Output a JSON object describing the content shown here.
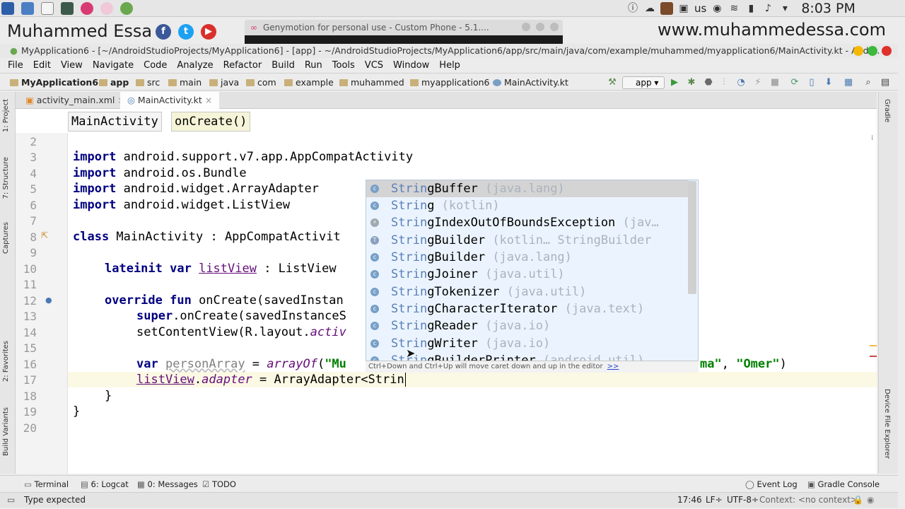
{
  "system_panel": {
    "keyboard_layout": "us",
    "clock": "8:03 PM",
    "tray_icons": [
      "info-icon",
      "cloud-icon",
      "avatar-icon",
      "package-icon",
      "wifi-icon",
      "battery-icon",
      "volume-icon",
      "chevron-down-icon"
    ]
  },
  "watermark": {
    "name": "Muhammed Essa",
    "url": "www.muhammedessa.com"
  },
  "genymotion_tab": {
    "title": "Genymotion for personal use - Custom Phone - 5.1...."
  },
  "window": {
    "title": "MyApplication6 - [~/AndroidStudioProjects/MyApplication6] - [app] - ~/AndroidStudioProjects/MyApplication6/app/src/main/java/com/example/muhammed/myapplication6/MainActivity.kt - Andr..."
  },
  "menu": [
    "File",
    "Edit",
    "View",
    "Navigate",
    "Code",
    "Analyze",
    "Refactor",
    "Build",
    "Run",
    "Tools",
    "VCS",
    "Window",
    "Help"
  ],
  "breadcrumbs": [
    "MyApplication6",
    "app",
    "src",
    "main",
    "java",
    "com",
    "example",
    "muhammed",
    "myapplication6",
    "MainActivity.kt"
  ],
  "run_config": "app",
  "tabs": [
    {
      "label": "activity_main.xml"
    },
    {
      "label": "MainActivity.kt"
    }
  ],
  "editor_breadcrumb": [
    "MainActivity",
    "onCreate()"
  ],
  "left_tool_windows": [
    "1: Project",
    "7: Structure",
    "Captures",
    "2: Favorites",
    "Build Variants"
  ],
  "right_tool_windows": [
    "Gradle",
    "Device File Explorer"
  ],
  "line_numbers": [
    "2",
    "3",
    "4",
    "5",
    "6",
    "7",
    "8",
    "9",
    "10",
    "11",
    "12",
    "13",
    "14",
    "15",
    "16",
    "17",
    "18",
    "19",
    "20"
  ],
  "code": {
    "l3_kw": "import",
    "l3_rest": " android.support.v7.app.AppCompatActivity",
    "l4_kw": "import",
    "l4_rest": " android.os.Bundle",
    "l5_kw": "import",
    "l5_rest": " android.widget.ArrayAdapter",
    "l6_kw": "import",
    "l6_rest": " android.widget.ListView",
    "l8_kw": "class",
    "l8_rest": " MainActivity : AppCompatActivit",
    "l10_kw": "lateinit var",
    "l10_name": "listView",
    "l10_rest": " : ListView",
    "l12_kw": "override fun",
    "l12_rest": " onCreate(savedInstan",
    "l13_kw": "super",
    "l13_rest": ".onCreate(savedInstanceS",
    "l14_a": "setContentView(R.layout.",
    "l14_b": "activ",
    "l16_kw": "var",
    "l16_name": "personArray",
    "l16_eq": " = ",
    "l16_fn": "arrayOf",
    "l16_open": "(",
    "l16_str1": "\"Mu",
    "l16_tail_str": "ma\"",
    "l16_comma": ", ",
    "l16_str2": "\"Omer\"",
    "l16_close": ")",
    "l17_name": "listView",
    "l17_dot": ".",
    "l17_prop": "adapter",
    "l17_rest": " = ArrayAdapter<Strin",
    "l18": "}",
    "l19": "}"
  },
  "completion": {
    "items": [
      {
        "match": "Strin",
        "rest": "gBuffer",
        "desc": " (java.lang)",
        "selected": true
      },
      {
        "match": "Strin",
        "rest": "g",
        "desc": " (kotlin)"
      },
      {
        "match": "Strin",
        "rest": "gIndexOutOfBoundsException",
        "desc": " (jav…"
      },
      {
        "match": "Strin",
        "rest": "gBuilder",
        "desc": " (kotlin… StringBuilder"
      },
      {
        "match": "Strin",
        "rest": "gBuilder",
        "desc": " (java.lang)"
      },
      {
        "match": "Strin",
        "rest": "gJoiner",
        "desc": " (java.util)"
      },
      {
        "match": "Strin",
        "rest": "gTokenizer",
        "desc": " (java.util)"
      },
      {
        "match": "Strin",
        "rest": "gCharacterIterator",
        "desc": " (java.text)"
      },
      {
        "match": "Strin",
        "rest": "gReader",
        "desc": " (java.io)"
      },
      {
        "match": "Strin",
        "rest": "gWriter",
        "desc": " (java.io)"
      },
      {
        "match": "Strin",
        "rest": "gBuilderPrinter",
        "desc": " (android.util)"
      }
    ],
    "hint": "Ctrl+Down and Ctrl+Up will move caret down and up in the editor",
    "hint_link": ">>"
  },
  "bottom_tools": [
    "Terminal",
    "6: Logcat",
    "0: Messages",
    "TODO",
    "Event Log",
    "Gradle Console"
  ],
  "status": {
    "message": "Type expected",
    "position": "17:46",
    "line_sep": "LF÷",
    "encoding": "UTF-8÷",
    "context": "Context: <no context>"
  },
  "colors": {
    "keyword": "#000080",
    "string": "#008000",
    "popup_bg": "#ebf4fe",
    "match": "#5a7fb8"
  }
}
